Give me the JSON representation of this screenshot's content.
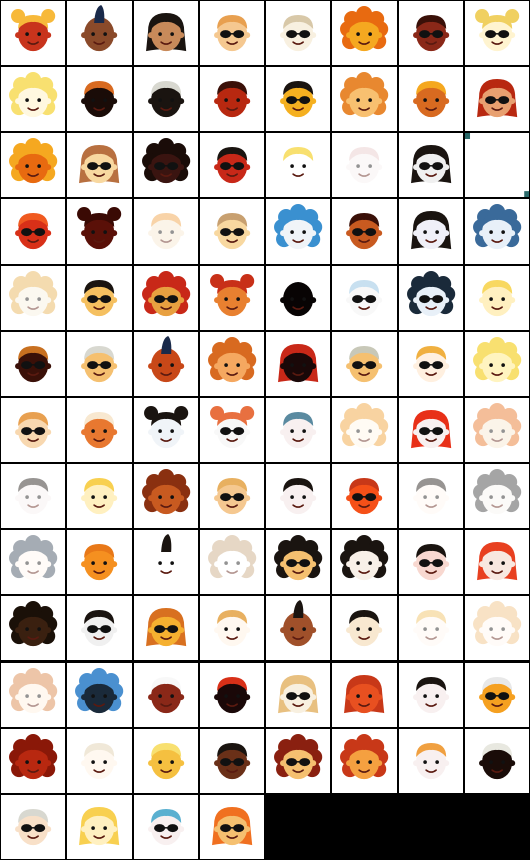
{
  "grid": {
    "columns": 8,
    "rows": 13,
    "tile_count": 100,
    "background": "#000000",
    "tile_background": "#ffffff"
  },
  "tiles": [
    {
      "variant": "avatar",
      "skin": "#c8341c",
      "hair": "#f7b93a",
      "hair_style": "buns",
      "glasses": false
    },
    {
      "variant": "avatar",
      "skin": "#8a4a2a",
      "hair": "#1a2a4a",
      "hair_style": "mohawk",
      "glasses": false
    },
    {
      "variant": "avatar",
      "skin": "#c88a5a",
      "hair": "#1a1410",
      "hair_style": "long",
      "glasses": false
    },
    {
      "variant": "avatar",
      "skin": "#f5c890",
      "hair": "#e8a050",
      "hair_style": "short",
      "glasses": true
    },
    {
      "variant": "avatar",
      "skin": "#f8f0e0",
      "hair": "#d8c8a8",
      "hair_style": "short",
      "glasses": true
    },
    {
      "variant": "avatar",
      "skin": "#f5a820",
      "hair": "#e86a10",
      "hair_style": "curly",
      "glasses": false
    },
    {
      "variant": "avatar",
      "skin": "#8a2818",
      "hair": "#3a1008",
      "hair_style": "short",
      "glasses": true
    },
    {
      "variant": "avatar",
      "skin": "#fff4d0",
      "hair": "#f0d060",
      "hair_style": "buns",
      "glasses": true
    },
    {
      "variant": "avatar",
      "skin": "#fff8e0",
      "hair": "#f8e070",
      "hair_style": "curly",
      "glasses": false
    },
    {
      "variant": "avatar",
      "skin": "#1a0c08",
      "hair": "#d86a20",
      "hair_style": "short",
      "glasses": false
    },
    {
      "variant": "avatar",
      "skin": "#1a1410",
      "hair": "#d8d8d0",
      "hair_style": "short",
      "glasses": false
    },
    {
      "variant": "avatar",
      "skin": "#b82810",
      "hair": "#3a1008",
      "hair_style": "short",
      "glasses": false
    },
    {
      "variant": "avatar",
      "skin": "#f5b020",
      "hair": "#1a1410",
      "hair_style": "short",
      "glasses": true
    },
    {
      "variant": "avatar",
      "skin": "#f8c070",
      "hair": "#e88830",
      "hair_style": "curly",
      "glasses": false
    },
    {
      "variant": "avatar",
      "skin": "#d86a20",
      "hair": "#f5a820",
      "hair_style": "short",
      "glasses": false
    },
    {
      "variant": "avatar",
      "skin": "#e8a070",
      "hair": "#b82810",
      "hair_style": "long",
      "glasses": true
    },
    {
      "variant": "avatar",
      "skin": "#e86a10",
      "hair": "#f5a820",
      "hair_style": "curly",
      "glasses": false
    },
    {
      "variant": "avatar",
      "skin": "#f8d8a0",
      "hair": "#b87040",
      "hair_style": "long",
      "glasses": true
    },
    {
      "variant": "avatar",
      "skin": "#3a1410",
      "hair": "#1a0c08",
      "hair_style": "curly",
      "glasses": true
    },
    {
      "variant": "avatar",
      "skin": "#c82818",
      "hair": "#1a1410",
      "hair_style": "short",
      "glasses": true
    },
    {
      "variant": "avatar",
      "skin": "#ffffff",
      "hair": "#f8e070",
      "hair_style": "short",
      "glasses": false
    },
    {
      "variant": "faint",
      "skin": "#f8f0f0",
      "hair": "#e8c8c8",
      "hair_style": "short",
      "glasses": false
    },
    {
      "variant": "avatar",
      "skin": "#f0f0f0",
      "hair": "#1a1410",
      "hair_style": "long",
      "glasses": true
    },
    {
      "variant": "blank",
      "skin": "#ffffff",
      "hair": "#2a6a6a",
      "hair_style": "none",
      "glasses": false
    },
    {
      "variant": "avatar",
      "skin": "#d83018",
      "hair": "#f05a20",
      "hair_style": "short",
      "glasses": true
    },
    {
      "variant": "avatar",
      "skin": "#5a1008",
      "hair": "#3a0a04",
      "hair_style": "buns",
      "glasses": false
    },
    {
      "variant": "faint",
      "skin": "#f8e8d0",
      "hair": "#f0a040",
      "hair_style": "short",
      "glasses": false
    },
    {
      "variant": "avatar",
      "skin": "#f8d8a0",
      "hair": "#c8a070",
      "hair_style": "short",
      "glasses": true
    },
    {
      "variant": "avatar",
      "skin": "#f0f4f8",
      "hair": "#3a90d0",
      "hair_style": "curly",
      "glasses": false
    },
    {
      "variant": "avatar",
      "skin": "#c85a20",
      "hair": "#3a1008",
      "hair_style": "short",
      "glasses": true
    },
    {
      "variant": "avatar",
      "skin": "#f0f0f8",
      "hair": "#1a1410",
      "hair_style": "long",
      "glasses": false
    },
    {
      "variant": "avatar",
      "skin": "#e8f0f8",
      "hair": "#3a6a9a",
      "hair_style": "curly",
      "glasses": false
    },
    {
      "variant": "faint",
      "skin": "#f8f0e0",
      "hair": "#e8b050",
      "hair_style": "curly",
      "glasses": false
    },
    {
      "variant": "avatar",
      "skin": "#f5c060",
      "hair": "#1a1410",
      "hair_style": "short",
      "glasses": true
    },
    {
      "variant": "avatar",
      "skin": "#e8a040",
      "hair": "#c82818",
      "hair_style": "curly",
      "glasses": true
    },
    {
      "variant": "avatar",
      "skin": "#e88030",
      "hair": "#c83018",
      "hair_style": "buns",
      "glasses": false
    },
    {
      "variant": "avatar",
      "skin": "#080404",
      "hair": "#080404",
      "hair_style": "none",
      "glasses": false
    },
    {
      "variant": "avatar",
      "skin": "#f8f8f8",
      "hair": "#c8e0f0",
      "hair_style": "short",
      "glasses": true
    },
    {
      "variant": "avatar",
      "skin": "#e8f0f8",
      "hair": "#1a2a3a",
      "hair_style": "curly",
      "glasses": true
    },
    {
      "variant": "avatar",
      "skin": "#fff0c0",
      "hair": "#f8d860",
      "hair_style": "short",
      "glasses": false
    },
    {
      "variant": "avatar",
      "skin": "#3a1008",
      "hair": "#c87020",
      "hair_style": "short",
      "glasses": true
    },
    {
      "variant": "avatar",
      "skin": "#f5c070",
      "hair": "#d8d8d0",
      "hair_style": "short",
      "glasses": true
    },
    {
      "variant": "avatar",
      "skin": "#c84818",
      "hair": "#1a2a4a",
      "hair_style": "mohawk",
      "glasses": false
    },
    {
      "variant": "avatar",
      "skin": "#f5a860",
      "hair": "#d86a20",
      "hair_style": "curly",
      "glasses": false
    },
    {
      "variant": "avatar",
      "skin": "#1a0808",
      "hair": "#c82818",
      "hair_style": "long",
      "glasses": false
    },
    {
      "variant": "avatar",
      "skin": "#f5c070",
      "hair": "#c8c8b8",
      "hair_style": "short",
      "glasses": true
    },
    {
      "variant": "avatar",
      "skin": "#fff0e0",
      "hair": "#f0b040",
      "hair_style": "short",
      "glasses": true
    },
    {
      "variant": "avatar",
      "skin": "#fff4c0",
      "hair": "#f8e070",
      "hair_style": "curly",
      "glasses": false
    },
    {
      "variant": "avatar",
      "skin": "#f8d8b0",
      "hair": "#e8a050",
      "hair_style": "short",
      "glasses": true
    },
    {
      "variant": "avatar",
      "skin": "#e87830",
      "hair": "#f8e8d0",
      "hair_style": "short",
      "glasses": false
    },
    {
      "variant": "avatar",
      "skin": "#f0f4f8",
      "hair": "#1a1410",
      "hair_style": "buns",
      "glasses": false
    },
    {
      "variant": "avatar",
      "skin": "#f8f8f8",
      "hair": "#e87040",
      "hair_style": "buns",
      "glasses": true
    },
    {
      "variant": "avatar",
      "skin": "#f8f0f0",
      "hair": "#5a8aa0",
      "hair_style": "short",
      "glasses": false
    },
    {
      "variant": "faint",
      "skin": "#fff8e8",
      "hair": "#f0a030",
      "hair_style": "curly",
      "glasses": false
    },
    {
      "variant": "avatar",
      "skin": "#f8f0f0",
      "hair": "#e83018",
      "hair_style": "long",
      "glasses": true
    },
    {
      "variant": "faint",
      "skin": "#f8e8d0",
      "hair": "#e87020",
      "hair_style": "curly",
      "glasses": false
    },
    {
      "variant": "faint",
      "skin": "#f8f0f0",
      "hair": "#1a1410",
      "hair_style": "short",
      "glasses": false
    },
    {
      "variant": "avatar",
      "skin": "#fff0c0",
      "hair": "#f8d050",
      "hair_style": "short",
      "glasses": false
    },
    {
      "variant": "avatar",
      "skin": "#c85a20",
      "hair": "#8a3010",
      "hair_style": "curly",
      "glasses": false
    },
    {
      "variant": "avatar",
      "skin": "#f5c890",
      "hair": "#e8b060",
      "hair_style": "short",
      "glasses": true
    },
    {
      "variant": "avatar",
      "skin": "#f8f0f0",
      "hair": "#1a1410",
      "hair_style": "short",
      "glasses": false
    },
    {
      "variant": "avatar",
      "skin": "#f55018",
      "hair": "#c83818",
      "hair_style": "short",
      "glasses": true
    },
    {
      "variant": "faint",
      "skin": "#fff8f0",
      "hair": "#1a1410",
      "hair_style": "short",
      "glasses": false
    },
    {
      "variant": "faint",
      "skin": "#f8f4f0",
      "hair": "#3a3a3a",
      "hair_style": "curly",
      "glasses": false
    },
    {
      "variant": "faint",
      "skin": "#fff8f0",
      "hair": "#3a4a5a",
      "hair_style": "curly",
      "glasses": false
    },
    {
      "variant": "avatar",
      "skin": "#f59020",
      "hair": "#e87818",
      "hair_style": "short",
      "glasses": false
    },
    {
      "variant": "avatar",
      "skin": "#ffffff",
      "hair": "#1a1410",
      "hair_style": "mohawk",
      "glasses": false
    },
    {
      "variant": "faint",
      "skin": "#ffffff",
      "hair": "#c8a880",
      "hair_style": "curly",
      "glasses": false
    },
    {
      "variant": "avatar",
      "skin": "#f5c070",
      "hair": "#1a1410",
      "hair_style": "curly",
      "glasses": true
    },
    {
      "variant": "avatar",
      "skin": "#f8f0e8",
      "hair": "#1a1410",
      "hair_style": "curly",
      "glasses": false
    },
    {
      "variant": "avatar",
      "skin": "#f8d8d0",
      "hair": "#1a1410",
      "hair_style": "short",
      "glasses": true
    },
    {
      "variant": "avatar",
      "skin": "#f8e8e0",
      "hair": "#e84020",
      "hair_style": "long",
      "glasses": false
    },
    {
      "variant": "avatar",
      "skin": "#3a2010",
      "hair": "#1a1008",
      "hair_style": "curly",
      "glasses": false
    },
    {
      "variant": "avatar",
      "skin": "#f0f0f0",
      "hair": "#1a1410",
      "hair_style": "short",
      "glasses": true
    },
    {
      "variant": "avatar",
      "skin": "#f5b030",
      "hair": "#d87020",
      "hair_style": "long",
      "glasses": true
    },
    {
      "variant": "avatar",
      "skin": "#fff8f0",
      "hair": "#e8b060",
      "hair_style": "short",
      "glasses": false
    },
    {
      "variant": "avatar",
      "skin": "#a0502a",
      "hair": "#1a1410",
      "hair_style": "mohawk",
      "glasses": false
    },
    {
      "variant": "avatar",
      "skin": "#f8e8d0",
      "hair": "#1a1410",
      "hair_style": "short",
      "glasses": false
    },
    {
      "variant": "faint",
      "skin": "#fff8f0",
      "hair": "#f0c060",
      "hair_style": "short",
      "glasses": false
    },
    {
      "variant": "faint",
      "skin": "#fff8f0",
      "hair": "#f0c080",
      "hair_style": "curly",
      "glasses": false
    },
    {
      "variant": "faint",
      "skin": "#fff0e0",
      "hair": "#d88040",
      "hair_style": "curly",
      "glasses": false
    },
    {
      "variant": "avatar",
      "skin": "#1a2a3a",
      "hair": "#4a90d0",
      "hair_style": "curly",
      "glasses": false
    },
    {
      "variant": "avatar",
      "skin": "#8a2818",
      "hair": "#f8f8f8",
      "hair_style": "short",
      "glasses": false
    },
    {
      "variant": "avatar",
      "skin": "#1a0808",
      "hair": "#d83018",
      "hair_style": "short",
      "glasses": false
    },
    {
      "variant": "avatar",
      "skin": "#f8f0e0",
      "hair": "#e8c080",
      "hair_style": "long",
      "glasses": true
    },
    {
      "variant": "avatar",
      "skin": "#e85020",
      "hair": "#c83818",
      "hair_style": "long",
      "glasses": false
    },
    {
      "variant": "avatar",
      "skin": "#f8f0f0",
      "hair": "#1a1410",
      "hair_style": "short",
      "glasses": false
    },
    {
      "variant": "avatar",
      "skin": "#f5a020",
      "hair": "#e8e8e8",
      "hair_style": "short",
      "glasses": true
    },
    {
      "variant": "avatar",
      "skin": "#b82810",
      "hair": "#8a1808",
      "hair_style": "curly",
      "glasses": false
    },
    {
      "variant": "avatar",
      "skin": "#fff8f0",
      "hair": "#f0e8d8",
      "hair_style": "short",
      "glasses": false
    },
    {
      "variant": "avatar",
      "skin": "#f5c040",
      "hair": "#f8e070",
      "hair_style": "short",
      "glasses": false
    },
    {
      "variant": "avatar",
      "skin": "#6a3018",
      "hair": "#1a1410",
      "hair_style": "short",
      "glasses": true
    },
    {
      "variant": "avatar",
      "skin": "#f5c070",
      "hair": "#8a2010",
      "hair_style": "curly",
      "glasses": true
    },
    {
      "variant": "avatar",
      "skin": "#f5a040",
      "hair": "#c83818",
      "hair_style": "curly",
      "glasses": false
    },
    {
      "variant": "avatar",
      "skin": "#f8f0f0",
      "hair": "#f0a040",
      "hair_style": "short",
      "glasses": false
    },
    {
      "variant": "avatar",
      "skin": "#1a0c08",
      "hair": "#e8e8e0",
      "hair_style": "short",
      "glasses": false
    },
    {
      "variant": "avatar",
      "skin": "#f8e0c8",
      "hair": "#d8d8d0",
      "hair_style": "short",
      "glasses": true
    },
    {
      "variant": "avatar",
      "skin": "#fff0c0",
      "hair": "#f8d050",
      "hair_style": "long",
      "glasses": false
    },
    {
      "variant": "avatar",
      "skin": "#f8f0f0",
      "hair": "#5ab0d0",
      "hair_style": "short",
      "glasses": true
    },
    {
      "variant": "avatar",
      "skin": "#f5c070",
      "hair": "#f07020",
      "hair_style": "long",
      "glasses": true
    }
  ]
}
